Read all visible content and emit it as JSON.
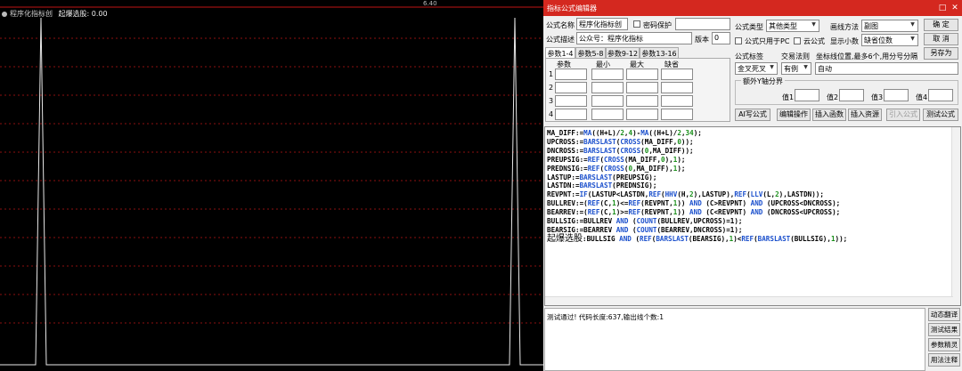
{
  "chart": {
    "indicator_name": "程序化指标创",
    "signal_label": "起爆选股: 0.00",
    "top_readout": "6.40"
  },
  "window": {
    "title": "指标公式编辑器",
    "formula_name_label": "公式名称",
    "formula_name_value": "程序化指标创",
    "password_label": "密码保护",
    "formula_desc_label": "公式描述",
    "formula_desc_value": "公众号：程序化指标",
    "version_label": "版本",
    "version_value": "0",
    "formula_type_label": "公式类型",
    "formula_type_value": "其他类型",
    "draw_method_label": "画线方法",
    "draw_method_value": "副图",
    "pc_only_label": "公式只用于PC",
    "cloud_label": "云公式",
    "decimals_label": "显示小数",
    "decimals_value": "缺省位数",
    "ok_label": "确 定",
    "cancel_label": "取 消",
    "save_as_label": "另存为",
    "tabs": [
      "参数1-4",
      "参数5-8",
      "参数9-12",
      "参数13-16"
    ],
    "param_headers": [
      "参数",
      "最小",
      "最大",
      "缺省"
    ],
    "param_rows": [
      "1",
      "2",
      "3",
      "4"
    ],
    "formula_tag_label": "公式标签",
    "trade_rule_label": "交易法则",
    "axis_label": "坐标线位置,最多6个,用分号分隔",
    "tag_value": "金叉死叉",
    "trade_value": "有例",
    "axis_value": "自动",
    "y_axis_group": "额外Y轴分界",
    "value_labels": [
      "值1",
      "值2",
      "值3",
      "值4"
    ],
    "buttons": {
      "ai": "AI写公式",
      "edit_op": "编辑操作",
      "insert_func": "插入函数",
      "insert_res": "插入资源",
      "import_formula": "引入公式",
      "test_formula": "测试公式"
    },
    "code": [
      "MA_DIFF:=MA((H+L)/2,4)-MA((H+L)/2,34);",
      "UPCROSS:=BARSLAST(CROSS(MA_DIFF,0));",
      "DNCROSS:=BARSLAST(CROSS(0,MA_DIFF));",
      "PREUPSIG:=REF(CROSS(MA_DIFF,0),1);",
      "PREDNSIG:=REF(CROSS(0,MA_DIFF),1);",
      "LASTUP:=BARSLAST(PREUPSIG);",
      "LASTDN:=BARSLAST(PREDNSIG);",
      "REVPNT:=IF(LASTUP<LASTDN,REF(HHV(H,2),LASTUP),REF(LLV(L,2),LASTDN));",
      "BULLREV:=(REF(C,1)<=REF(REVPNT,1)) AND (C>REVPNT) AND (UPCROSS<DNCROSS);",
      "BEARREV:=(REF(C,1)>=REF(REVPNT,1)) AND (C<REVPNT) AND (DNCROSS<UPCROSS);",
      "BULLSIG:=BULLREV AND (COUNT(BULLREV,UPCROSS)=1);",
      "BEARSIG:=BEARREV AND (COUNT(BEARREV,DNCROSS)=1);",
      "起爆选股:BULLSIG AND (REF(BARSLAST(BEARSIG),1)<REF(BARSLAST(BULLSIG),1));"
    ],
    "status_text": "测试通过! 代码长度:637,输出线个数:1",
    "side_buttons": [
      "动态翻译",
      "测试结果",
      "参数精灵",
      "用法注释"
    ]
  }
}
